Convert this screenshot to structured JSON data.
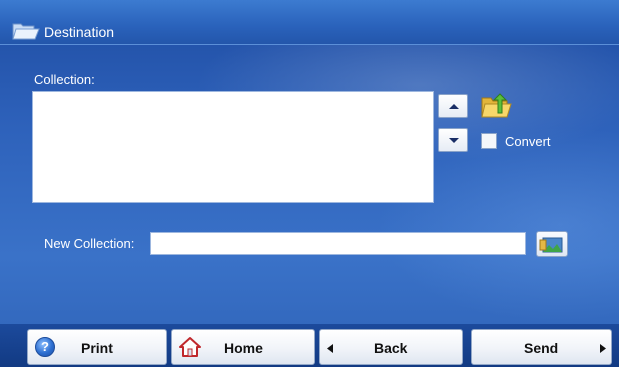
{
  "window": {
    "title": "Destination"
  },
  "collection": {
    "label": "Collection:",
    "items": []
  },
  "convert": {
    "label": "Convert",
    "checked": false
  },
  "new_collection": {
    "label": "New Collection:",
    "value": "",
    "placeholder": ""
  },
  "nav": {
    "print_label": "Print",
    "home_label": "Home",
    "back_label": "Back",
    "send_label": "Send"
  },
  "icons": {
    "title": "folder-open-icon",
    "folder_up": "folder-up-icon",
    "browse": "folder-image-icon",
    "help": "help-icon",
    "home": "home-icon",
    "back": "back-arrow-icon",
    "send": "forward-arrow-icon",
    "scroll_up": "arrow-up-icon",
    "scroll_down": "arrow-down-icon"
  },
  "colors": {
    "background": "#2e62bb",
    "titlebar": "#2a62bb",
    "button_face": "#f1f4f9",
    "text_on_blue": "#ffffff"
  }
}
